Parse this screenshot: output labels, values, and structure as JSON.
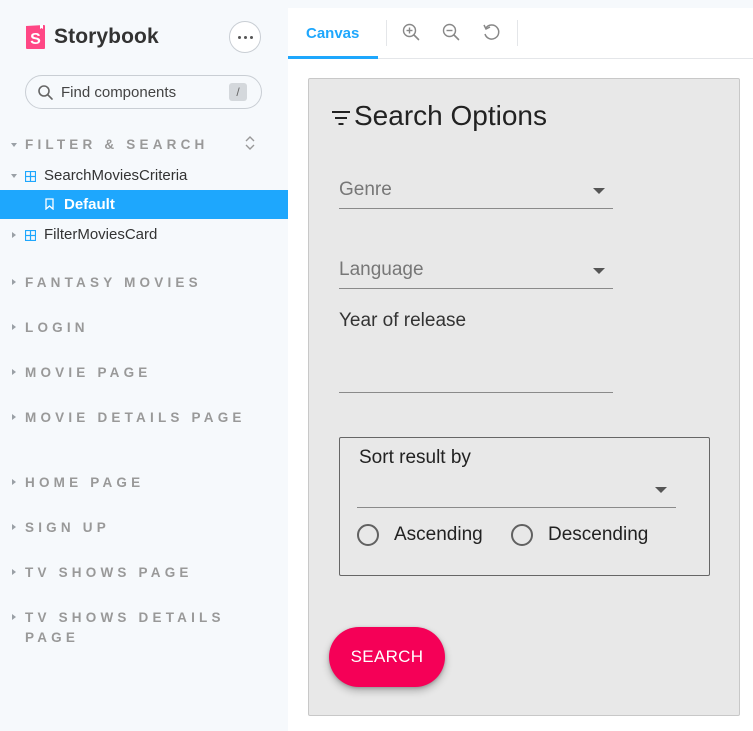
{
  "app": {
    "brand_name": "Storybook",
    "search_placeholder": "Find components",
    "search_shortcut": "/"
  },
  "sidebar": {
    "groups": [
      {
        "label": "FILTER & SEARCH",
        "expanded": true
      },
      {
        "label": "FANTASY MOVIES"
      },
      {
        "label": "LOGIN"
      },
      {
        "label": "MOVIE PAGE"
      },
      {
        "label": "MOVIE DETAILS PAGE"
      },
      {
        "label": "HOME PAGE"
      },
      {
        "label": "SIGN UP"
      },
      {
        "label": "TV SHOWS PAGE"
      },
      {
        "label": "TV SHOWS DETAILS PAGE"
      }
    ],
    "components": [
      {
        "label": "SearchMoviesCriteria",
        "expanded": true
      },
      {
        "label": "FilterMoviesCard",
        "expanded": false
      }
    ],
    "selected_story": "Default"
  },
  "toolbar": {
    "tab_canvas": "Canvas",
    "icons": [
      "zoom-in-icon",
      "zoom-out-icon",
      "reset-zoom-icon"
    ]
  },
  "form": {
    "title": "Search Options",
    "genre_placeholder": "Genre",
    "language_placeholder": "Language",
    "year_label": "Year of release",
    "year_value": "",
    "sort_label": "Sort result by",
    "sort_value": "",
    "radio_ascending": "Ascending",
    "radio_descending": "Descending",
    "search_button": "SEARCH"
  },
  "colors": {
    "accent": "#1ea7fd",
    "brand": "#ff4785",
    "search_button": "#f50057",
    "card_bg": "#e8e8e8"
  }
}
